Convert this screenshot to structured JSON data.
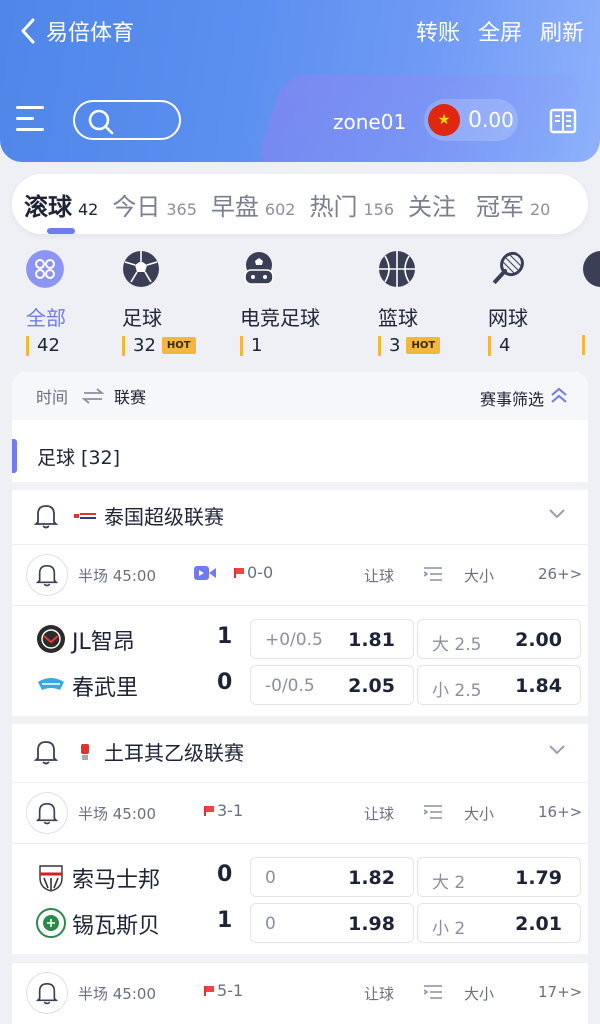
{
  "nav": {
    "title": "易倍体育",
    "actions": [
      "转账",
      "全屏",
      "刷新"
    ]
  },
  "account": {
    "username": "zone01",
    "balance_int": "0",
    "balance_dec": ".00"
  },
  "tabs": [
    {
      "label": "滚球",
      "count": "42",
      "active": true
    },
    {
      "label": "今日",
      "count": "365"
    },
    {
      "label": "早盘",
      "count": "602"
    },
    {
      "label": "热门",
      "count": "156"
    },
    {
      "label": "关注",
      "count": ""
    },
    {
      "label": "冠军",
      "count": "20"
    }
  ],
  "sports": [
    {
      "label": "全部",
      "count": "42",
      "icon": "grid-icon",
      "hot": ""
    },
    {
      "label": "足球",
      "count": "32",
      "icon": "soccer-ball-icon",
      "hot": "HOT"
    },
    {
      "label": "电竞足球",
      "count": "1",
      "icon": "esports-soccer-icon",
      "hot": ""
    },
    {
      "label": "篮球",
      "count": "3",
      "icon": "basketball-icon",
      "hot": "HOT"
    },
    {
      "label": "网球",
      "count": "4",
      "icon": "tennis-racket-icon",
      "hot": ""
    }
  ],
  "list_header": {
    "time": "时间",
    "league": "联赛",
    "filter": "赛事筛选"
  },
  "section": {
    "title": "足球 [32]"
  },
  "leagues": [
    {
      "name": "泰国超级联赛",
      "match": {
        "time": "半场 45:00",
        "corners": "0-0",
        "handicap_label": "让球",
        "ou_label": "大小",
        "more": "26+>",
        "teams": [
          {
            "name": "JL智昂",
            "score": "1",
            "hc_line": "+0/0.5",
            "hc_odd": "1.81",
            "ou_line": "大 2.5",
            "ou_odd": "2.00"
          },
          {
            "name": "春武里",
            "score": "0",
            "hc_line": "-0/0.5",
            "hc_odd": "2.05",
            "ou_line": "小 2.5",
            "ou_odd": "1.84"
          }
        ]
      }
    },
    {
      "name": "土耳其乙级联赛",
      "match": {
        "time": "半场 45:00",
        "corners": "3-1",
        "handicap_label": "让球",
        "ou_label": "大小",
        "more": "16+>",
        "teams": [
          {
            "name": "索马士邦",
            "score": "0",
            "hc_line": "0",
            "hc_odd": "1.82",
            "ou_line": "大 2",
            "ou_odd": "1.79"
          },
          {
            "name": "锡瓦斯贝",
            "score": "1",
            "hc_line": "0",
            "hc_odd": "1.98",
            "ou_line": "小 2",
            "ou_odd": "2.01"
          }
        ]
      }
    }
  ],
  "next_match": {
    "time": "半场 45:00",
    "corners": "5-1",
    "handicap_label": "让球",
    "ou_label": "大小",
    "more": "17+>"
  },
  "colors": {
    "accent": "#6f7cf0",
    "banner": "#5b8ff0",
    "hot": "#f4b73d"
  }
}
